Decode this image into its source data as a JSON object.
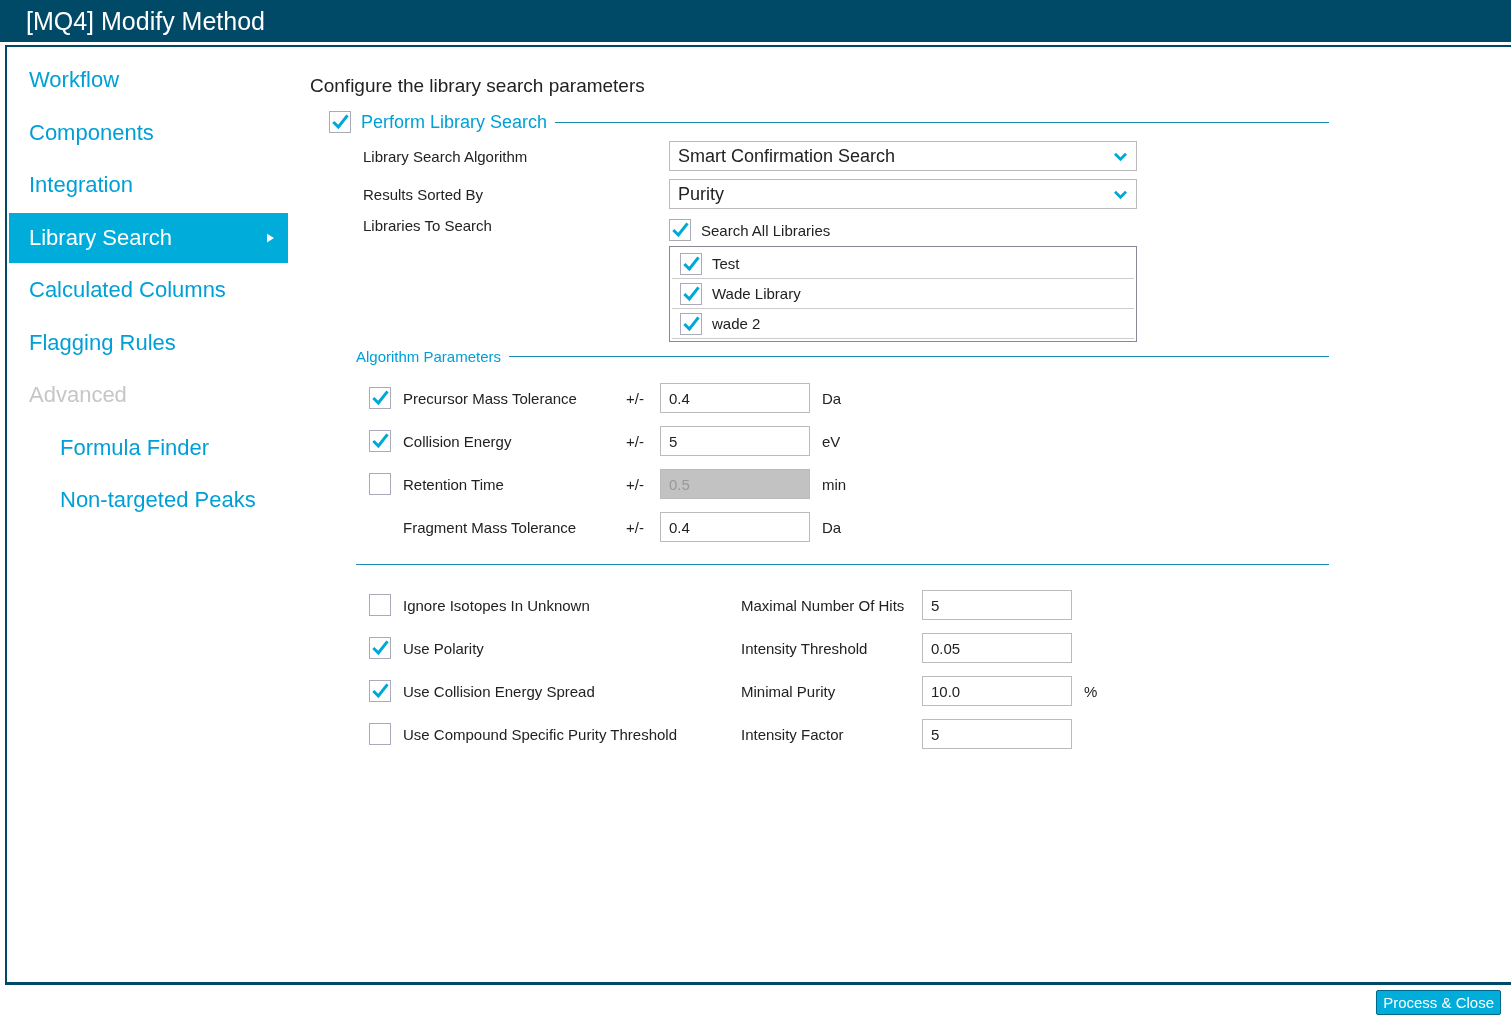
{
  "window": {
    "title": "[MQ4] Modify Method"
  },
  "sidebar": {
    "items": [
      {
        "label": "Workflow",
        "selected": false,
        "disabled": false,
        "kind": "top"
      },
      {
        "label": "Components",
        "selected": false,
        "disabled": false,
        "kind": "top"
      },
      {
        "label": "Integration",
        "selected": false,
        "disabled": false,
        "kind": "top"
      },
      {
        "label": "Library Search",
        "selected": true,
        "disabled": false,
        "kind": "top"
      },
      {
        "label": "Calculated Columns",
        "selected": false,
        "disabled": false,
        "kind": "top"
      },
      {
        "label": "Flagging Rules",
        "selected": false,
        "disabled": false,
        "kind": "top"
      },
      {
        "label": "Advanced",
        "selected": false,
        "disabled": true,
        "kind": "top"
      },
      {
        "label": "Formula Finder",
        "selected": false,
        "disabled": false,
        "kind": "sub"
      },
      {
        "label": "Non-targeted Peaks",
        "selected": false,
        "disabled": false,
        "kind": "sub"
      }
    ]
  },
  "heading": "Configure the library search parameters",
  "perform": {
    "label": "Perform Library Search",
    "checked": true
  },
  "algorithm": {
    "label": "Library Search Algorithm",
    "value": "Smart Confirmation Search"
  },
  "sorted_by": {
    "label": "Results Sorted By",
    "value": "Purity"
  },
  "libraries": {
    "label": "Libraries To Search",
    "all_label": "Search All Libraries",
    "all_checked": true,
    "items": [
      {
        "name": "Test",
        "checked": true
      },
      {
        "name": "Wade Library",
        "checked": true
      },
      {
        "name": "wade 2",
        "checked": true
      }
    ]
  },
  "algorithm_parameters": {
    "title": "Algorithm Parameters",
    "rows": [
      {
        "kind": "checkbox",
        "label": "Precursor Mass Tolerance",
        "checked": true,
        "sign": "+/-",
        "value": "0.4",
        "disabled": false,
        "unit": "Da"
      },
      {
        "kind": "checkbox",
        "label": "Collision Energy",
        "checked": true,
        "sign": "+/-",
        "value": "5",
        "disabled": false,
        "unit": "eV"
      },
      {
        "kind": "checkbox",
        "label": "Retention Time",
        "checked": false,
        "sign": "+/-",
        "value": "0.5",
        "disabled": true,
        "unit": "min"
      },
      {
        "kind": "plain",
        "label": "Fragment Mass Tolerance",
        "sign": "+/-",
        "value": "0.4",
        "disabled": false,
        "unit": "Da"
      }
    ]
  },
  "options": [
    {
      "label": "Ignore Isotopes In Unknown",
      "checked": false,
      "setting": "Maximal Number Of Hits",
      "value": "5"
    },
    {
      "label": "Use Polarity",
      "checked": true,
      "setting": "Intensity Threshold",
      "value": "0.05"
    },
    {
      "label": "Use Collision Energy Spread",
      "checked": true,
      "setting": "Minimal Purity",
      "value": "10.0",
      "unit": "%"
    },
    {
      "label": "Use Compound Specific Purity Threshold",
      "checked": false,
      "setting": "Intensity Factor",
      "value": "5"
    }
  ],
  "buttons": [
    {
      "label": "Process & Close"
    }
  ]
}
